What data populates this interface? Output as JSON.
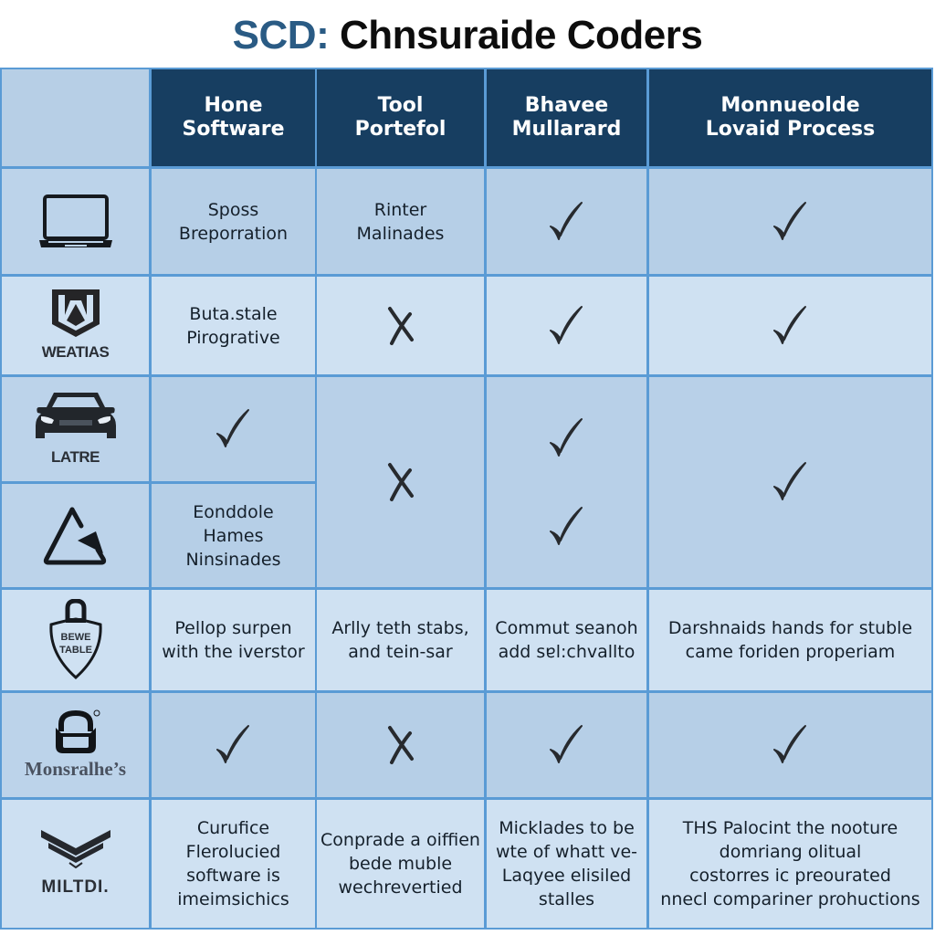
{
  "title": {
    "accent": "SCD:",
    "rest": " Chnsuraide Coders"
  },
  "colors": {
    "header_bg": "#173e61",
    "grid_line": "#5a9bd5",
    "accent": "#2a5b84"
  },
  "columns": [
    {
      "line1": "Hone",
      "line2": "Software"
    },
    {
      "line1": "Tool",
      "line2": "Portefol"
    },
    {
      "line1": "Bhavee",
      "line2": "Mullarard"
    },
    {
      "line1": "Monnueolde",
      "line2": "Lovaid Process"
    }
  ],
  "rows": [
    {
      "logo": {
        "icon": "laptop-icon",
        "label": ""
      },
      "cells": [
        {
          "type": "text",
          "lines": [
            "Sposs",
            "Breporration"
          ]
        },
        {
          "type": "text",
          "lines": [
            "Rinter",
            "Malinades"
          ]
        },
        {
          "type": "check"
        },
        {
          "type": "check"
        }
      ]
    },
    {
      "logo": {
        "icon": "shield-w-icon",
        "label": "WEATIAS"
      },
      "cells": [
        {
          "type": "text",
          "lines": [
            "Buta.stale",
            "Pirogrative"
          ]
        },
        {
          "type": "cross"
        },
        {
          "type": "check"
        },
        {
          "type": "check"
        }
      ]
    },
    {
      "logo": {
        "icon": "car-icon",
        "label": "LATRE"
      },
      "cells": [
        {
          "type": "check"
        },
        {
          "type": "cross",
          "rowspan": 2
        },
        {
          "type": "check"
        },
        {
          "type": "check",
          "rowspan": 2
        }
      ]
    },
    {
      "logo": {
        "icon": "triangle-arrow-icon",
        "label": ""
      },
      "cells": [
        {
          "type": "text",
          "lines": [
            "Eonddole",
            "Hames",
            "Ninsinades"
          ]
        },
        {
          "type": "check"
        }
      ]
    },
    {
      "logo": {
        "icon": "padlock-shield-icon",
        "label": "",
        "inner": [
          "BEWE",
          "TABLE"
        ]
      },
      "cells": [
        {
          "type": "text",
          "lines": [
            "Pellop surpen",
            "with the iverstor"
          ]
        },
        {
          "type": "text",
          "lines": [
            "Arlly teth stabs,",
            "and tein-sar"
          ]
        },
        {
          "type": "text",
          "lines": [
            "Commut seanoh",
            "add sɐl:chvallto"
          ]
        },
        {
          "type": "text",
          "lines": [
            "Darshnaids hands for stuble",
            "came foriden properiam"
          ]
        }
      ]
    },
    {
      "logo": {
        "icon": "bag-icon",
        "label": "Monsralhe’s"
      },
      "cells": [
        {
          "type": "check"
        },
        {
          "type": "cross"
        },
        {
          "type": "check"
        },
        {
          "type": "check"
        }
      ]
    },
    {
      "logo": {
        "icon": "chevron-wings-icon",
        "label": "MILTDI."
      },
      "cells": [
        {
          "type": "text",
          "lines": [
            "Curufice",
            "Flerolucied",
            "software is",
            "imeimsichics"
          ]
        },
        {
          "type": "text",
          "lines": [
            "Conprade a oiffien",
            "bede muble",
            "wechrevertied"
          ]
        },
        {
          "type": "text",
          "lines": [
            "Micklades to be",
            "wte of whatt ve-",
            "Laqyee elisiled",
            "stalles"
          ]
        },
        {
          "type": "text",
          "lines": [
            "THS Palocint the nooture",
            "domriang olitual",
            "costorres ic preourated",
            "nnecl compariner prohuctions"
          ]
        }
      ]
    }
  ]
}
